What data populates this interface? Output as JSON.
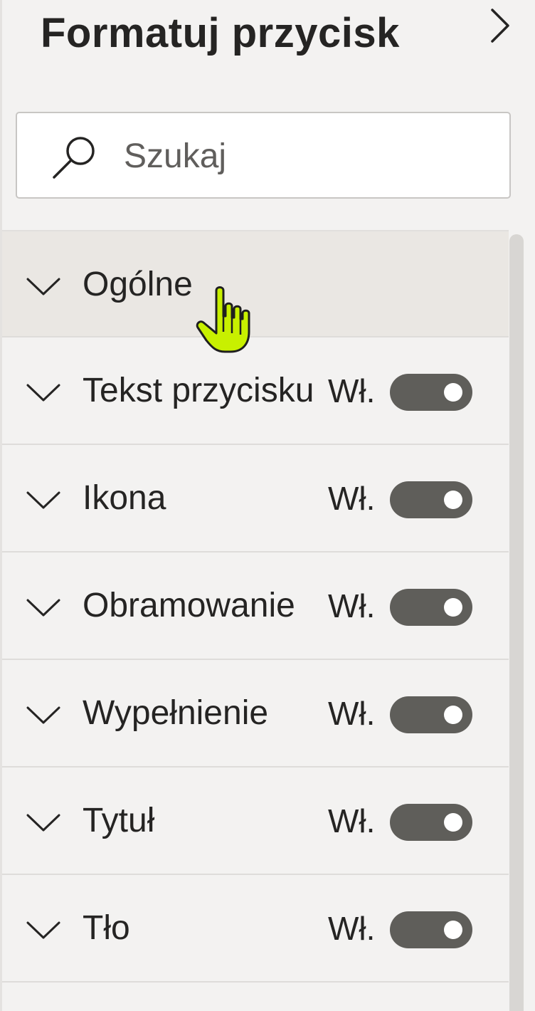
{
  "header": {
    "title": "Formatuj przycisk"
  },
  "search": {
    "placeholder": "Szukaj",
    "value": ""
  },
  "sections": [
    {
      "label": "Ogólne",
      "has_toggle": false
    },
    {
      "label": "Tekst przycisku",
      "has_toggle": true,
      "toggle_label": "Wł.",
      "toggle_on": true
    },
    {
      "label": "Ikona",
      "has_toggle": true,
      "toggle_label": "Wł.",
      "toggle_on": true
    },
    {
      "label": "Obramowanie",
      "has_toggle": true,
      "toggle_label": "Wł.",
      "toggle_on": true
    },
    {
      "label": "Wypełnienie",
      "has_toggle": true,
      "toggle_label": "Wł.",
      "toggle_on": true
    },
    {
      "label": "Tytuł",
      "has_toggle": true,
      "toggle_label": "Wł.",
      "toggle_on": true
    },
    {
      "label": "Tło",
      "has_toggle": true,
      "toggle_label": "Wł.",
      "toggle_on": true
    }
  ],
  "icons": {
    "collapse": "chevron-right-icon",
    "search": "search-icon",
    "expand": "chevron-down-icon",
    "cursor": "hand-pointer-cursor-icon"
  },
  "colors": {
    "toggle_on": "#5f5e5a",
    "cursor": "#c8f000",
    "hover_row": "#eae7e3"
  }
}
